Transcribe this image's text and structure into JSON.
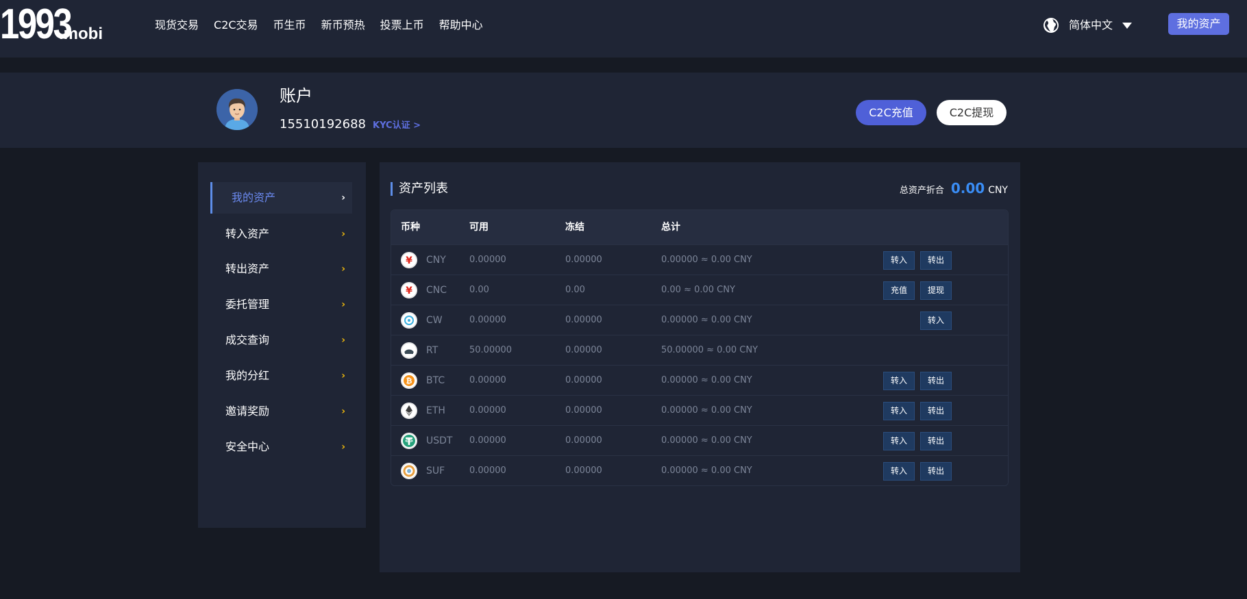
{
  "header": {
    "logo_main": "1993",
    "logo_suffix": ".mobi",
    "nav": [
      "现货交易",
      "C2C交易",
      "币生币",
      "新币预热",
      "投票上币",
      "帮助中心"
    ],
    "language": "简体中文",
    "my_assets_label": "我的资产"
  },
  "account": {
    "title": "账户",
    "phone": "15510192688",
    "kyc_label": "KYC认证 >",
    "c2c_deposit_label": "C2C充值",
    "c2c_withdraw_label": "C2C提现"
  },
  "sidebar": {
    "items": [
      {
        "label": "我的资产",
        "active": true
      },
      {
        "label": "转入资产"
      },
      {
        "label": "转出资产"
      },
      {
        "label": "委托管理"
      },
      {
        "label": "成交查询"
      },
      {
        "label": "我的分红"
      },
      {
        "label": "邀请奖励"
      },
      {
        "label": "安全中心"
      }
    ],
    "chevron": "›"
  },
  "assets": {
    "title": "资产列表",
    "total_label": "总资产折合",
    "total_value": "0.00",
    "total_unit": "CNY",
    "columns": [
      "币种",
      "可用",
      "冻结",
      "总计"
    ],
    "rows": [
      {
        "coin": "CNY",
        "icon": "yuan-icon",
        "available": "0.00000",
        "frozen": "0.00000",
        "total": "0.00000 ≈ 0.00 CNY",
        "actions": [
          "转入",
          "转出"
        ]
      },
      {
        "coin": "CNC",
        "icon": "yuan-icon",
        "available": "0.00",
        "frozen": "0.00",
        "total": "0.00 ≈ 0.00 CNY",
        "actions": [
          "充值",
          "提现"
        ]
      },
      {
        "coin": "CW",
        "icon": "cw-coin-icon",
        "available": "0.00000",
        "frozen": "0.00000",
        "total": "0.00000 ≈ 0.00 CNY",
        "actions": [
          "转入"
        ]
      },
      {
        "coin": "RT",
        "icon": "rt-coin-icon",
        "available": "50.00000",
        "frozen": "0.00000",
        "total": "50.00000 ≈ 0.00 CNY",
        "actions": []
      },
      {
        "coin": "BTC",
        "icon": "bitcoin-icon",
        "available": "0.00000",
        "frozen": "0.00000",
        "total": "0.00000 ≈ 0.00 CNY",
        "actions": [
          "转入",
          "转出"
        ]
      },
      {
        "coin": "ETH",
        "icon": "ethereum-icon",
        "available": "0.00000",
        "frozen": "0.00000",
        "total": "0.00000 ≈ 0.00 CNY",
        "actions": [
          "转入",
          "转出"
        ]
      },
      {
        "coin": "USDT",
        "icon": "tether-icon",
        "available": "0.00000",
        "frozen": "0.00000",
        "total": "0.00000 ≈ 0.00 CNY",
        "actions": [
          "转入",
          "转出"
        ]
      },
      {
        "coin": "SUF",
        "icon": "suf-coin-icon",
        "available": "0.00000",
        "frozen": "0.00000",
        "total": "0.00000 ≈ 0.00 CNY",
        "actions": [
          "转入",
          "转出"
        ]
      }
    ]
  },
  "colors": {
    "accent": "#5e6fe0",
    "total_value": "#3a8df5",
    "chevron": "#f0b90b"
  }
}
